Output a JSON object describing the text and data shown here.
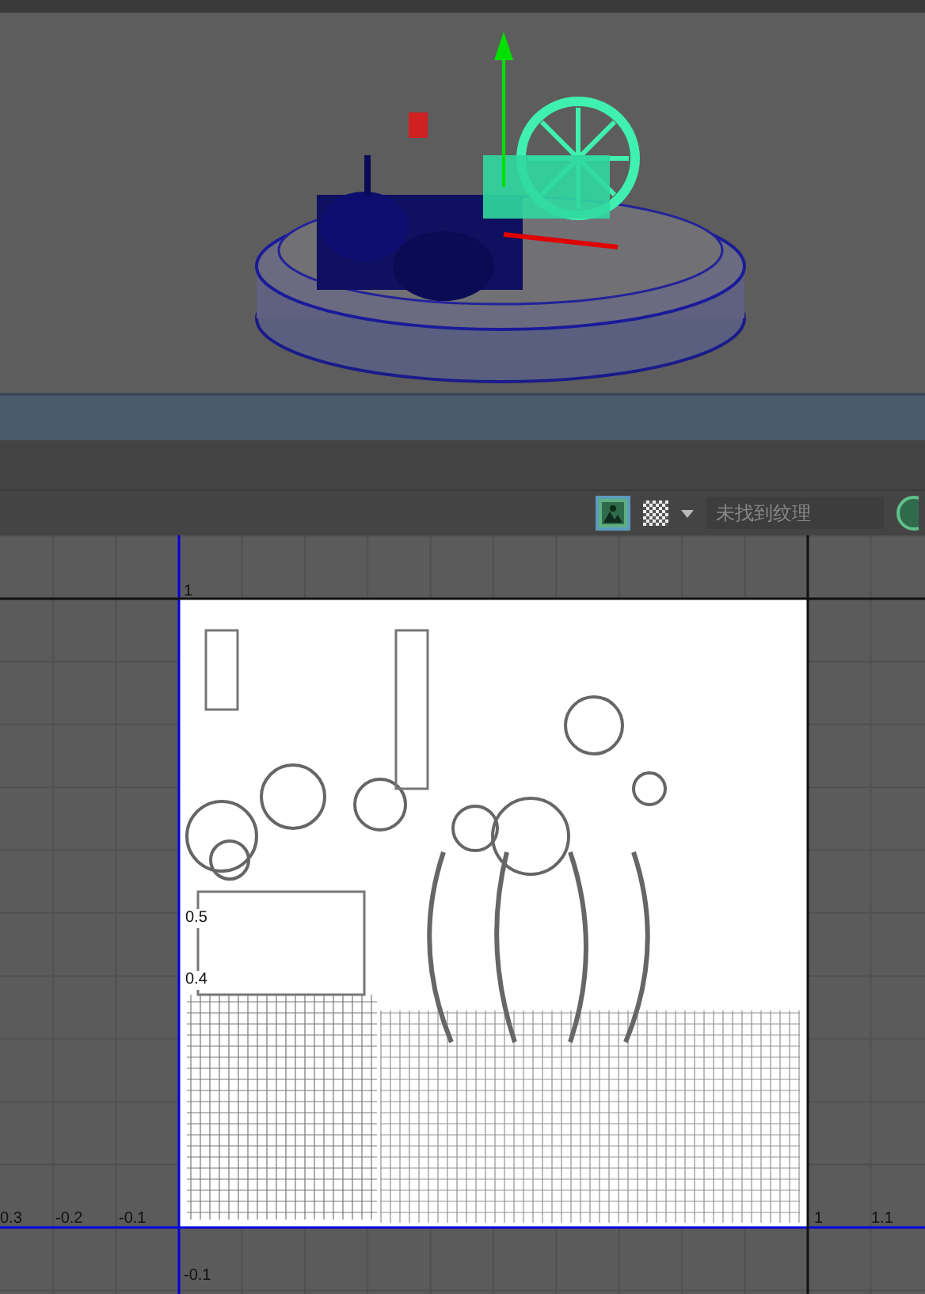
{
  "uv_toolbar": {
    "image_toggle": {
      "selected": true
    },
    "texture_field": {
      "placeholder": "未找到纹理"
    }
  },
  "uv_editor": {
    "u_labels": [
      "0.3",
      "-0.2",
      "-0.1",
      "1",
      "1.1"
    ],
    "v_labels": [
      "1",
      "0.5",
      "0.4",
      "-0.1"
    ]
  }
}
